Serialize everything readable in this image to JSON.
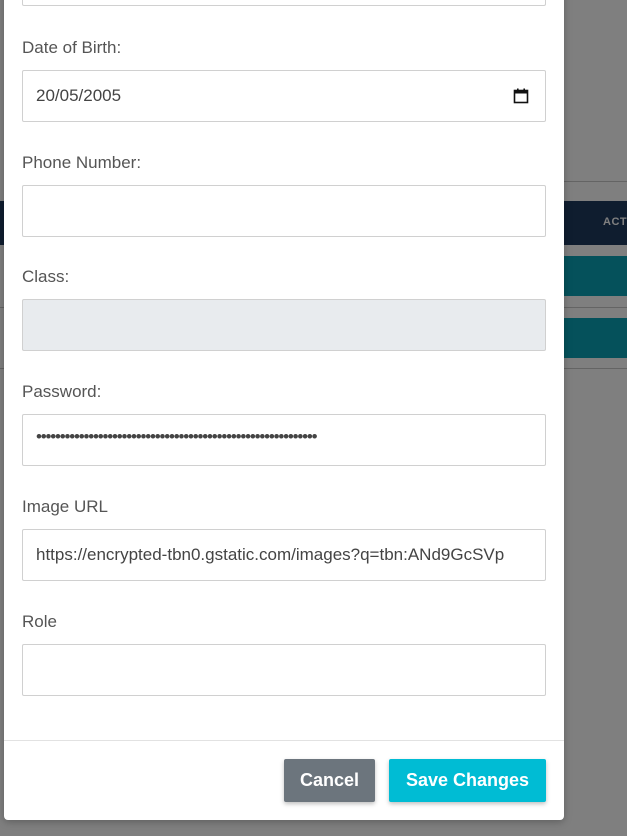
{
  "background": {
    "table_header_label": "ACT"
  },
  "form": {
    "date_of_birth": {
      "label": "Date of Birth:",
      "value": "20/05/2005"
    },
    "phone_number": {
      "label": "Phone Number:",
      "value": ""
    },
    "class": {
      "label": "Class:",
      "value": ""
    },
    "password": {
      "label": "Password:",
      "value": "•••••••••••••••••••••••••••••••••••••••••••••••••••••••••••"
    },
    "image_url": {
      "label": "Image URL",
      "value": "https://encrypted-tbn0.gstatic.com/images?q=tbn:ANd9GcSVp"
    },
    "role": {
      "label": "Role",
      "value": ""
    }
  },
  "footer": {
    "cancel_label": "Cancel",
    "save_label": "Save Changes"
  },
  "colors": {
    "primary": "#00bcd4",
    "secondary": "#6c757d",
    "table_header": "#1f3a5f",
    "row_action": "#0aa3b7"
  },
  "icons": {
    "date_picker": "calendar-icon"
  }
}
